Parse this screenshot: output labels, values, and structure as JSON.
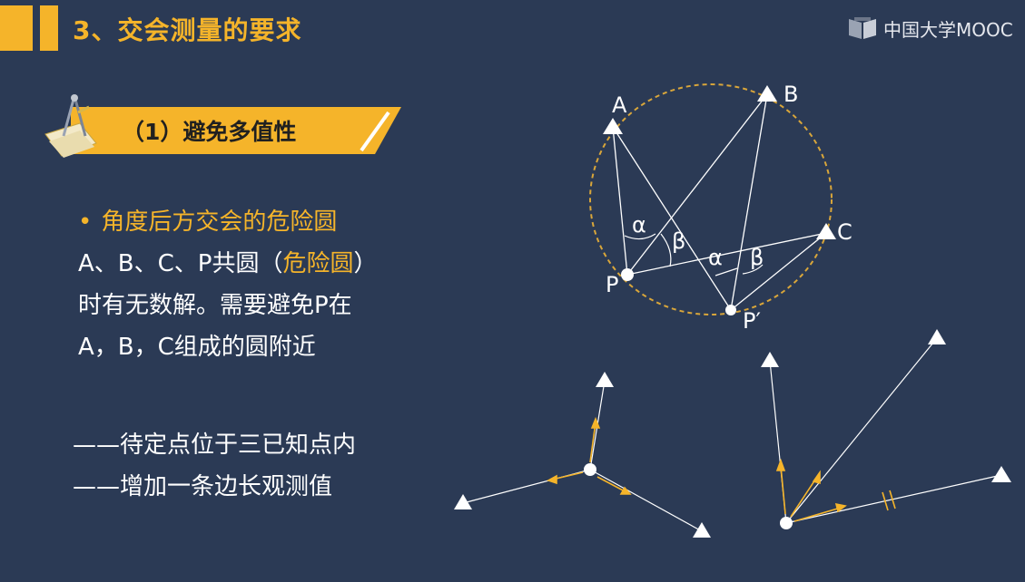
{
  "header": {
    "title": "3、交会测量的要求",
    "logo_text": "中国大学MOOC"
  },
  "subheading": "（1）避免多值性",
  "content": {
    "bullet": "角度后方交会的危险圆",
    "line1_a": "A、B、C、P共圆（",
    "line1_hl": "危险圆",
    "line1_b": "）",
    "line2": "时有无数解。需要避免P在",
    "line3": "A，B，C组成的圆附近",
    "dash1": "——待定点位于三已知点内",
    "dash2": "——增加一条边长观测值"
  },
  "diagram": {
    "labels": {
      "A": "A",
      "B": "B",
      "C": "C",
      "P": "P",
      "P_prime": "P′",
      "alpha1": "α",
      "beta1": "β",
      "alpha2": "α",
      "beta2": "β"
    }
  },
  "colors": {
    "background": "#2b3a55",
    "accent": "#f5b42a",
    "text": "#ffffff"
  }
}
